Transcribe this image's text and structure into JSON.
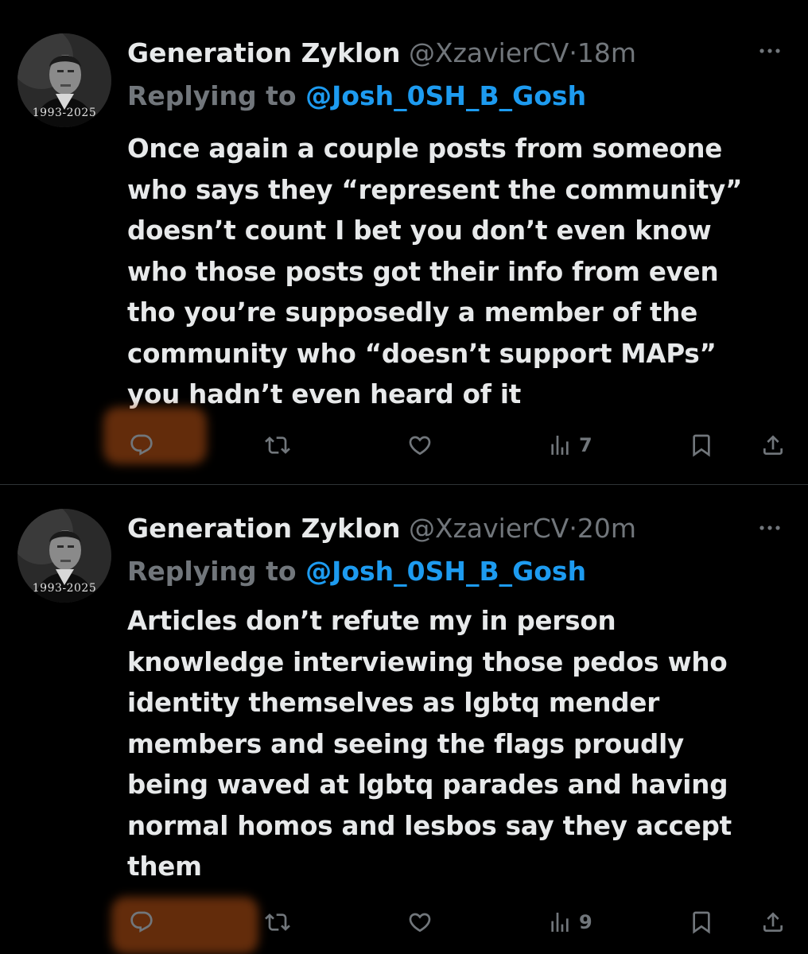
{
  "colors": {
    "background": "#000000",
    "text": "#e7e9ea",
    "muted": "#71767b",
    "link": "#1d9bf0",
    "divider": "#2f3336",
    "highlight": "#b4501a"
  },
  "tweets": [
    {
      "avatar": {
        "icon": "profile-photo",
        "years": "1993-2025"
      },
      "display_name": "Generation Zyklon",
      "handle": "@XzavierCV",
      "dot": "·",
      "timestamp": "18m",
      "reply_prefix": "Replying to ",
      "reply_handle": "@Josh_0SH_B_Gosh",
      "body": "Once again a couple posts from someone\nwho says they “represent the community”\ndoesn’t count I bet you don’t even know\nwho those posts got their info from even\ntho you’re supposedly a member of the\ncommunity who “doesn’t support MAPs”\nyou hadn’t even heard of it",
      "actions": {
        "reply_icon": "reply-icon",
        "retweet_icon": "retweet-icon",
        "like_icon": "heart-icon",
        "views_icon": "bar-chart-icon",
        "views": "7",
        "bookmark_icon": "bookmark-icon",
        "share_icon": "share-icon"
      }
    },
    {
      "avatar": {
        "icon": "profile-photo",
        "years": "1993-2025"
      },
      "display_name": "Generation Zyklon",
      "handle": "@XzavierCV",
      "dot": "·",
      "timestamp": "20m",
      "reply_prefix": "Replying to ",
      "reply_handle": "@Josh_0SH_B_Gosh",
      "body": "Articles don’t refute my in person\nknowledge interviewing those pedos who\nidentity themselves as lgbtq mender\nmembers and seeing the flags proudly\nbeing waved at lgbtq parades and having\nnormal homos and lesbos say they accept\nthem",
      "actions": {
        "reply_icon": "reply-icon",
        "retweet_icon": "retweet-icon",
        "like_icon": "heart-icon",
        "views_icon": "bar-chart-icon",
        "views": "9",
        "bookmark_icon": "bookmark-icon",
        "share_icon": "share-icon"
      }
    }
  ]
}
